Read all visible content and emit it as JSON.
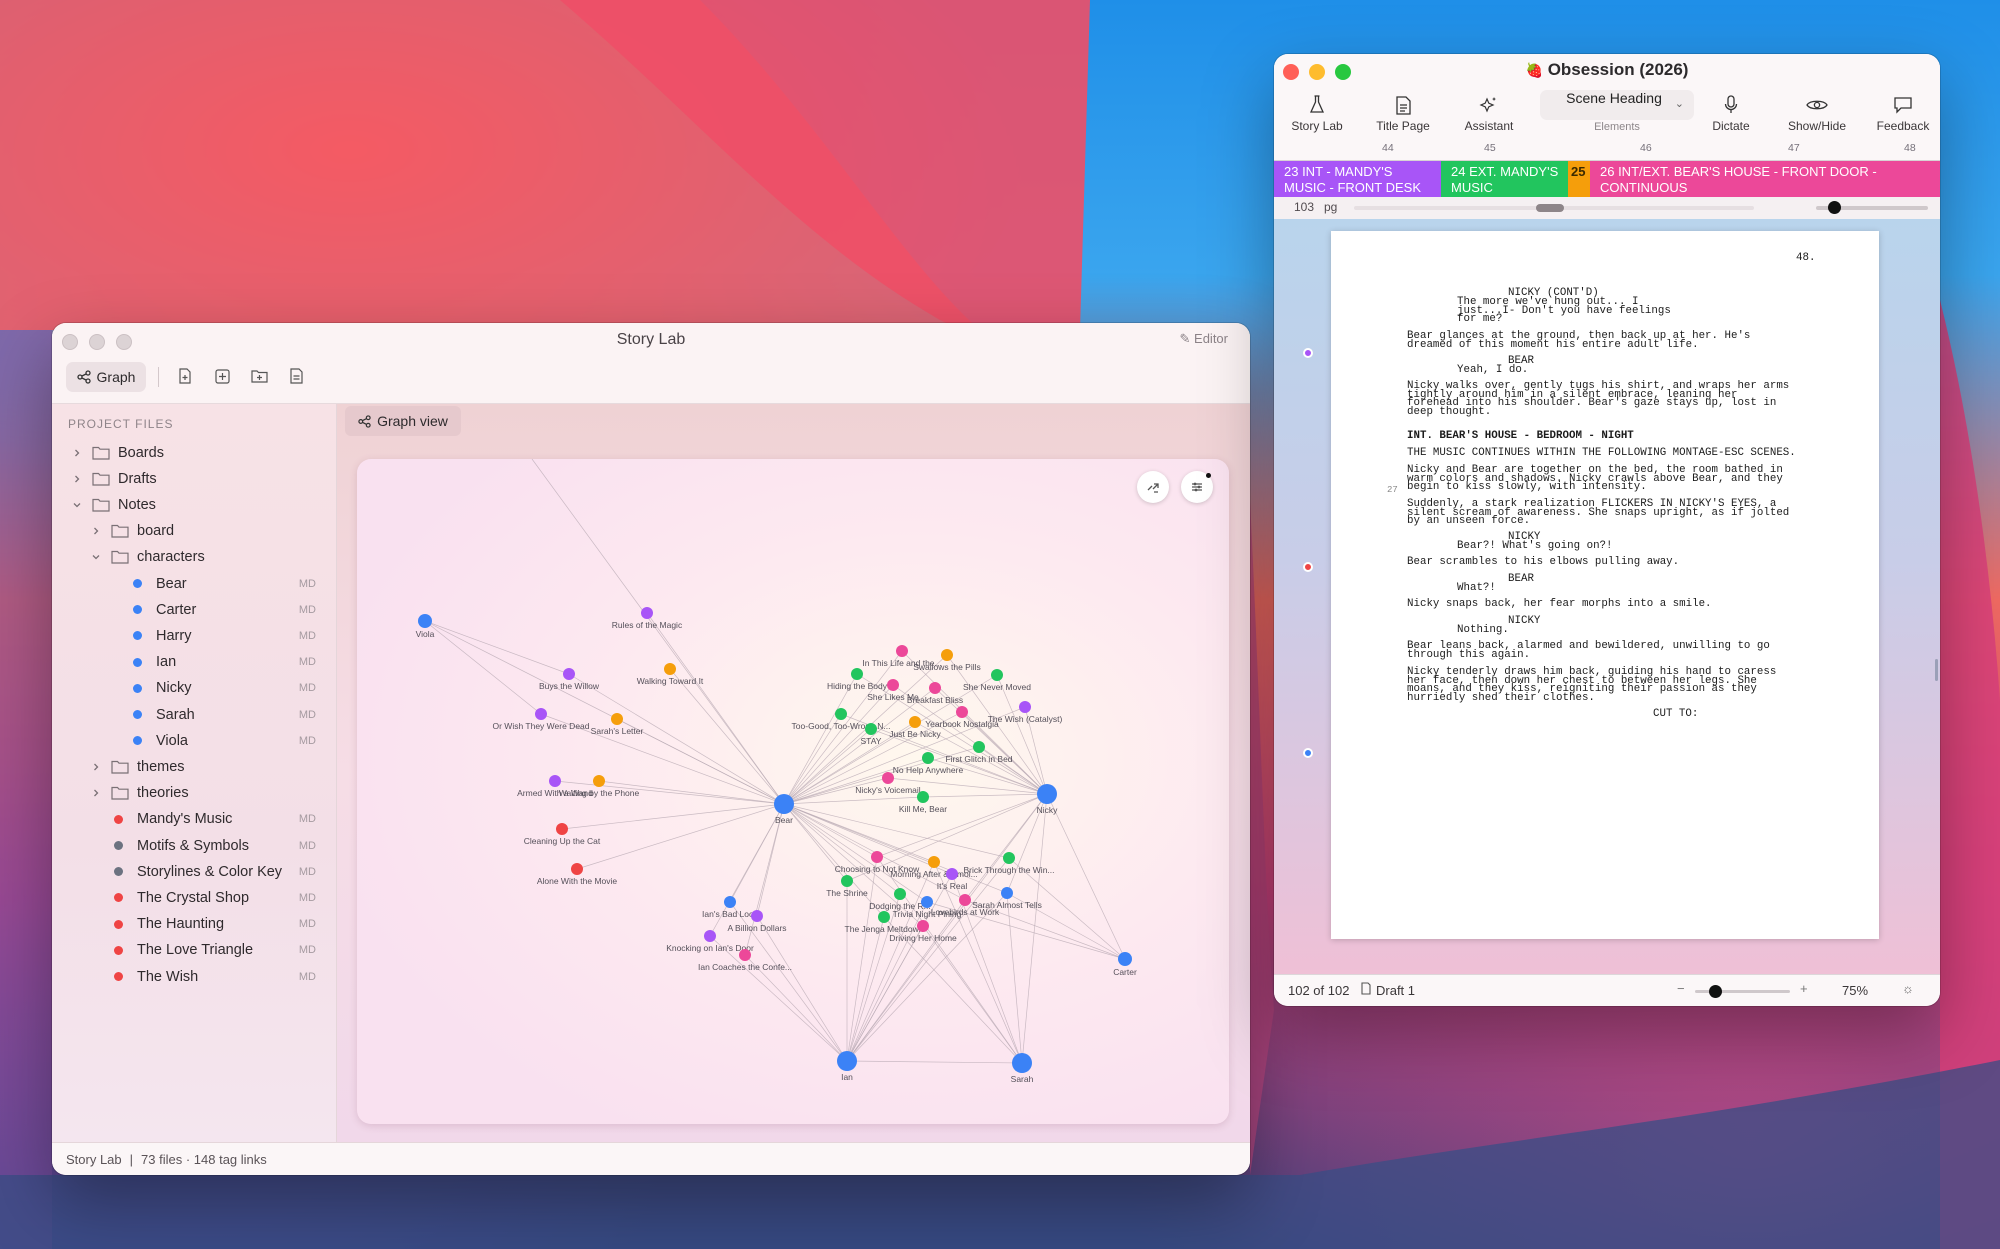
{
  "wallpaper": {
    "colors": [
      "#1f8fe8",
      "#f06a62",
      "#c6407c",
      "#2b3f78"
    ]
  },
  "story_lab": {
    "title": "Story Lab",
    "editor_label": "Editor",
    "graph_button": "Graph",
    "project_files_label": "PROJECT FILES",
    "graph_view_tab": "Graph view",
    "tree": [
      {
        "label": "Boards",
        "type": "folder",
        "depth": 0,
        "expanded": false
      },
      {
        "label": "Drafts",
        "type": "folder",
        "depth": 0,
        "expanded": false
      },
      {
        "label": "Notes",
        "type": "folder",
        "depth": 0,
        "expanded": true
      },
      {
        "label": "board",
        "type": "folder",
        "depth": 1,
        "expanded": false
      },
      {
        "label": "characters",
        "type": "folder",
        "depth": 1,
        "expanded": true
      },
      {
        "label": "Bear",
        "type": "file",
        "depth": 2,
        "badge": "MD",
        "color": "#3b82f6"
      },
      {
        "label": "Carter",
        "type": "file",
        "depth": 2,
        "badge": "MD",
        "color": "#3b82f6"
      },
      {
        "label": "Harry",
        "type": "file",
        "depth": 2,
        "badge": "MD",
        "color": "#3b82f6"
      },
      {
        "label": "Ian",
        "type": "file",
        "depth": 2,
        "badge": "MD",
        "color": "#3b82f6"
      },
      {
        "label": "Nicky",
        "type": "file",
        "depth": 2,
        "badge": "MD",
        "color": "#3b82f6"
      },
      {
        "label": "Sarah",
        "type": "file",
        "depth": 2,
        "badge": "MD",
        "color": "#3b82f6"
      },
      {
        "label": "Viola",
        "type": "file",
        "depth": 2,
        "badge": "MD",
        "color": "#3b82f6"
      },
      {
        "label": "themes",
        "type": "folder",
        "depth": 1,
        "expanded": false
      },
      {
        "label": "theories",
        "type": "folder",
        "depth": 1,
        "expanded": false
      },
      {
        "label": "Mandy's Music",
        "type": "file",
        "depth": 1,
        "badge": "MD",
        "color": "#ef4444"
      },
      {
        "label": "Motifs & Symbols",
        "type": "file",
        "depth": 1,
        "badge": "MD",
        "color": "#6b7280"
      },
      {
        "label": "Storylines & Color Key",
        "type": "file",
        "depth": 1,
        "badge": "MD",
        "color": "#6b7280"
      },
      {
        "label": "The Crystal Shop",
        "type": "file",
        "depth": 1,
        "badge": "MD",
        "color": "#ef4444"
      },
      {
        "label": "The Haunting",
        "type": "file",
        "depth": 1,
        "badge": "MD",
        "color": "#ef4444"
      },
      {
        "label": "The Love Triangle",
        "type": "file",
        "depth": 1,
        "badge": "MD",
        "color": "#ef4444"
      },
      {
        "label": "The Wish",
        "type": "file",
        "depth": 1,
        "badge": "MD",
        "color": "#ef4444"
      }
    ],
    "status_app": "Story Lab",
    "status_sep": "|",
    "status_counts": "73 files · 148 tag links",
    "graph": {
      "colors": {
        "blue": "#3b82f6",
        "purple": "#a855f7",
        "orange": "#f59e0b",
        "green": "#22c55e",
        "pink": "#ec4899",
        "red": "#ef4444"
      },
      "hubs": [
        {
          "label": "Bear",
          "color": "blue"
        },
        {
          "label": "Nicky",
          "color": "blue"
        },
        {
          "label": "Ian",
          "color": "blue"
        },
        {
          "label": "Sarah",
          "color": "blue"
        },
        {
          "label": "Carter",
          "color": "blue"
        },
        {
          "label": "Viola",
          "color": "blue"
        }
      ],
      "nodes": [
        {
          "label": "Rules of the Magic",
          "color": "purple"
        },
        {
          "label": "Buys the Willow",
          "color": "purple"
        },
        {
          "label": "Walking Toward It",
          "color": "orange"
        },
        {
          "label": "Or Wish They Were Dead",
          "color": "purple"
        },
        {
          "label": "Sarah's Letter",
          "color": "orange"
        },
        {
          "label": "Armed With a Wand",
          "color": "purple"
        },
        {
          "label": "Waiting by the Phone",
          "color": "orange"
        },
        {
          "label": "Cleaning Up the Cat",
          "color": "red"
        },
        {
          "label": "Alone With the Movie",
          "color": "red"
        },
        {
          "label": "In This Life and the...",
          "color": "pink"
        },
        {
          "label": "Swallows the Pills",
          "color": "orange"
        },
        {
          "label": "Hiding the Body",
          "color": "green"
        },
        {
          "label": "She Likes Me",
          "color": "pink"
        },
        {
          "label": "She Never Moved",
          "color": "green"
        },
        {
          "label": "Breakfast Bliss",
          "color": "pink"
        },
        {
          "label": "The Wish (Catalyst)",
          "color": "purple"
        },
        {
          "label": "Too-Good, Too-Wrong N...",
          "color": "green"
        },
        {
          "label": "Yearbook Nostalgia",
          "color": "pink"
        },
        {
          "label": "Just Be Nicky",
          "color": "orange"
        },
        {
          "label": "STAY",
          "color": "green"
        },
        {
          "label": "First Glitch in Bed",
          "color": "green"
        },
        {
          "label": "No Help Anywhere",
          "color": "green"
        },
        {
          "label": "Nicky's Voicemail",
          "color": "pink"
        },
        {
          "label": "Kill Me, Bear",
          "color": "green"
        },
        {
          "label": "Choosing to Not Know",
          "color": "pink"
        },
        {
          "label": "Brick Through the Win...",
          "color": "green"
        },
        {
          "label": "Morning After & Smol...",
          "color": "orange"
        },
        {
          "label": "The Shrine",
          "color": "green"
        },
        {
          "label": "It's Real",
          "color": "purple"
        },
        {
          "label": "Dodging the R...",
          "color": "green"
        },
        {
          "label": "Sarah Almost Tells",
          "color": "blue"
        },
        {
          "label": "Trivia Night Pining",
          "color": "blue"
        },
        {
          "label": "The Jenga Meltdown",
          "color": "green"
        },
        {
          "label": "Lovebirds at Work",
          "color": "pink"
        },
        {
          "label": "Driving Her Home",
          "color": "pink"
        },
        {
          "label": "Ian's Bad Look",
          "color": "blue"
        },
        {
          "label": "A Billion Dollars",
          "color": "purple"
        },
        {
          "label": "Knocking on Ian's Door",
          "color": "purple"
        },
        {
          "label": "Ian Coaches the Confe...",
          "color": "pink"
        }
      ]
    }
  },
  "obsession": {
    "title": "Obsession (2026)",
    "toolbar": [
      {
        "label": "Story Lab",
        "icon": "flask-icon"
      },
      {
        "label": "Title Page",
        "icon": "document-icon"
      },
      {
        "label": "Assistant",
        "icon": "sparkles-icon"
      },
      {
        "label": "Dictate",
        "icon": "microphone-icon"
      },
      {
        "label": "Show/Hide",
        "icon": "eye-icon"
      },
      {
        "label": "Feedback",
        "icon": "speech-bubble-icon"
      }
    ],
    "element_select": {
      "value": "Scene Heading",
      "caption": "Elements"
    },
    "ruler_ticks": [
      "44",
      "45",
      "46",
      "47",
      "48"
    ],
    "scene_strip": [
      {
        "text": "23 INT - MANDY'S MUSIC - FRONT DESK",
        "color": "#a855f7"
      },
      {
        "text": "24 EXT. MANDY'S MUSIC",
        "color": "#22c55e"
      },
      {
        "text": "25",
        "color": "#f59e0b"
      },
      {
        "text": "26 INT/EXT. BEAR'S HOUSE - FRONT DOOR - CONTINUOUS",
        "color": "#ec4899"
      }
    ],
    "page_count": "103",
    "page_unit": "pg",
    "page": {
      "page_number": "48.",
      "scene_number": "27",
      "lines": [
        "NICKY (CONT'D)",
        "The more we've hung out... I",
        "just...I- Don't you have feelings",
        "for me?",
        "Bear glances at the ground, then back up at her. He's",
        "dreamed of this moment his entire adult life.",
        "BEAR",
        "Yeah, I do.",
        "Nicky walks over, gently tugs his shirt, and wraps her arms",
        "tightly around him in a silent embrace, leaning her",
        "forehead into his shoulder. Bear's gaze stays up, lost in",
        "deep thought.",
        "INT. BEAR'S HOUSE - BEDROOM - NIGHT",
        "THE MUSIC CONTINUES WITHIN THE FOLLOWING MONTAGE-ESC SCENES.",
        "Nicky and Bear are together on the bed, the room bathed in",
        "warm colors and shadows. Nicky crawls above Bear, and they",
        "begin to kiss slowly, with intensity.",
        "Suddenly, a stark realization FLICKERS IN NICKY'S EYES, a",
        "silent scream of awareness. She snaps upright, as if jolted",
        "by an unseen force.",
        "NICKY",
        "Bear?! What's going on?!",
        "Bear scrambles to his elbows pulling away.",
        "BEAR",
        "What?!",
        "Nicky snaps back, her fear morphs into a smile.",
        "NICKY",
        "Nothing.",
        "Bear leans back, alarmed and bewildered, unwilling to go",
        "through this again.",
        "Nicky tenderly draws him back, guiding his hand to caress",
        "her face, then down her chest to between her legs. She",
        "moans, and they kiss, reigniting their passion as they",
        "hurriedly shed their clothes.",
        "CUT TO:"
      ]
    },
    "margin_markers": [
      "#a855f7",
      "#ef4444",
      "#3b82f6"
    ],
    "status": {
      "page_of": "102 of 102",
      "draft": "Draft 1",
      "zoom": "75%",
      "minus": "−",
      "plus": "+"
    }
  }
}
